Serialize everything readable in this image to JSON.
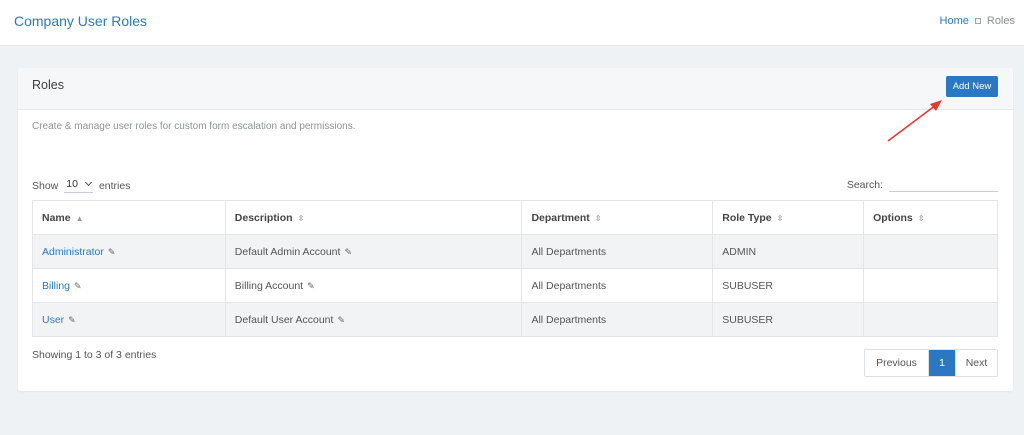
{
  "header": {
    "title": "Company User Roles",
    "breadcrumb": {
      "home": "Home",
      "current": "Roles"
    }
  },
  "card": {
    "title": "Roles",
    "add_button": "Add New",
    "description": "Create & manage user roles for custom form escalation and permissions."
  },
  "table_controls": {
    "show_label": "Show",
    "length_value": "10",
    "entries_label": "entries",
    "search_label": "Search:",
    "search_value": ""
  },
  "table": {
    "columns": [
      "Name",
      "Description",
      "Department",
      "Role Type",
      "Options"
    ],
    "rows": [
      {
        "name": "Administrator",
        "description": "Default Admin Account",
        "department": "All Departments",
        "role_type": "ADMIN",
        "options": ""
      },
      {
        "name": "Billing",
        "description": "Billing Account",
        "department": "All Departments",
        "role_type": "SUBUSER",
        "options": ""
      },
      {
        "name": "User",
        "description": "Default User Account",
        "department": "All Departments",
        "role_type": "SUBUSER",
        "options": ""
      }
    ]
  },
  "footer": {
    "info": "Showing 1 to 3 of 3 entries",
    "pagination": {
      "previous": "Previous",
      "current": "1",
      "next": "Next"
    }
  },
  "colors": {
    "accent": "#2a78c4",
    "annotation_arrow": "#e53935"
  }
}
